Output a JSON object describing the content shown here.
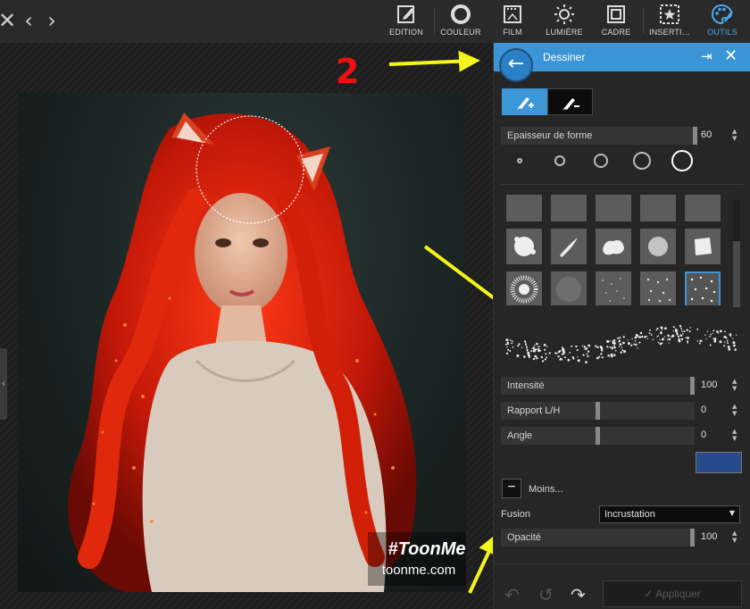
{
  "nav": {
    "close": "✕",
    "back": "‹",
    "forward": "›"
  },
  "toolbar": {
    "items": [
      {
        "label": "EDITION",
        "icon": "edit-icon"
      },
      {
        "label": "COULEUR",
        "icon": "color-circle-icon"
      },
      {
        "label": "FILM",
        "icon": "film-icon"
      },
      {
        "label": "LUMIÈRE",
        "icon": "sun-icon"
      },
      {
        "label": "CADRE",
        "icon": "frame-icon"
      },
      {
        "label": "INSERTI…",
        "icon": "insert-star-icon"
      },
      {
        "label": "OUTILS",
        "icon": "palette-icon",
        "active": true
      }
    ],
    "active_color": "#4aa8ec"
  },
  "photo": {
    "watermark_title": "#ToonMe",
    "watermark_url": "toonme.com"
  },
  "annotation": {
    "number": "2",
    "number_color": "#e11111",
    "arrow_color": "#f5f51a"
  },
  "panel": {
    "title": "Dessiner",
    "header_color": "#3c95d6",
    "back_icon": "←",
    "pin_icon": "⇥",
    "close_icon": "✕",
    "thickness": {
      "label": "Epaisseur de forme",
      "value": "60"
    },
    "intensity": {
      "label": "Intensité",
      "value": "100",
      "level": 1.0
    },
    "ratio": {
      "label": "Rapport L/H",
      "value": "0",
      "level": 0.5
    },
    "angle": {
      "label": "Angle",
      "value": "0",
      "level": 0.5
    },
    "color": "#264a8c",
    "less_label": "Moins...",
    "less_icon": "−",
    "fusion": {
      "label": "Fusion",
      "value": "Incrustation"
    },
    "opacity": {
      "label": "Opacité",
      "value": "100",
      "level": 1.0
    },
    "apply_label": "Appliquer",
    "apply_icon": "✓"
  }
}
